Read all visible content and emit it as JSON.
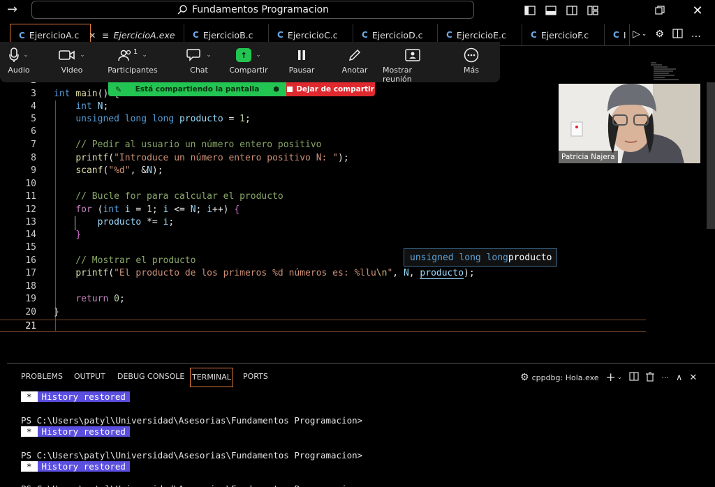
{
  "titlebar": {
    "search_text": "Fundamentos Programacion"
  },
  "tabs": [
    {
      "label": "EjercicioA.c",
      "icon": "C"
    },
    {
      "label": "EjercicioA.exe",
      "icon": "≡"
    },
    {
      "label": "EjercicioB.c",
      "icon": "C"
    },
    {
      "label": "EjercicioC.c",
      "icon": "C"
    },
    {
      "label": "EjercicioD.c",
      "icon": "C"
    },
    {
      "label": "EjercicioE.c",
      "icon": "C"
    },
    {
      "label": "EjercicioF.c",
      "icon": "C"
    },
    {
      "label": "I",
      "icon": "C"
    }
  ],
  "zoom": {
    "audio": "Audio",
    "video": "Video",
    "participants": "Participantes",
    "participants_count": "1",
    "chat": "Chat",
    "share": "Compartir",
    "pause": "Pausar",
    "annotate": "Anotar",
    "show_meeting": "Mostrar reunión",
    "more": "Más",
    "sharing_banner": "Está compartiendo la pantalla",
    "stop_sharing": "Dejar de compartir"
  },
  "webcam": {
    "name": "Patricia Najera"
  },
  "editor": {
    "lines": [
      {
        "n": "2",
        "code": ""
      },
      {
        "n": "3",
        "code": "int main() {"
      },
      {
        "n": "4",
        "code": "    int N;"
      },
      {
        "n": "5",
        "code": "    unsigned long long producto = 1;"
      },
      {
        "n": "6",
        "code": ""
      },
      {
        "n": "7",
        "code": "    // Pedir al usuario un número entero positivo"
      },
      {
        "n": "8",
        "code": "    printf(\"Introduce un número entero positivo N: \");"
      },
      {
        "n": "9",
        "code": "    scanf(\"%d\", &N);"
      },
      {
        "n": "10",
        "code": ""
      },
      {
        "n": "11",
        "code": "    // Bucle for para calcular el producto"
      },
      {
        "n": "12",
        "code": "    for (int i = 1; i <= N; i++) {"
      },
      {
        "n": "13",
        "code": "        producto *= i;"
      },
      {
        "n": "14",
        "code": "    }"
      },
      {
        "n": "15",
        "code": ""
      },
      {
        "n": "16",
        "code": "    // Mostrar el producto"
      },
      {
        "n": "17",
        "code": "    printf(\"El producto de los primeros %d números es: %llu\\n\", N, producto);"
      },
      {
        "n": "18",
        "code": ""
      },
      {
        "n": "19",
        "code": "    return 0;"
      },
      {
        "n": "20",
        "code": "}"
      },
      {
        "n": "21",
        "code": ""
      }
    ],
    "hover_type": "unsigned long long",
    "hover_name": "producto"
  },
  "panel": {
    "tabs": [
      "PROBLEMS",
      "OUTPUT",
      "DEBUG CONSOLE",
      "TERMINAL",
      "PORTS"
    ],
    "active_tab": "TERMINAL",
    "terminal_name": "cppdbg: Hola.exe",
    "history_star": "*",
    "history_msg": "History restored",
    "prompt": "PS C:\\Users\\patyl\\Universidad\\Asesorias\\Fundamentos Programacion>"
  }
}
